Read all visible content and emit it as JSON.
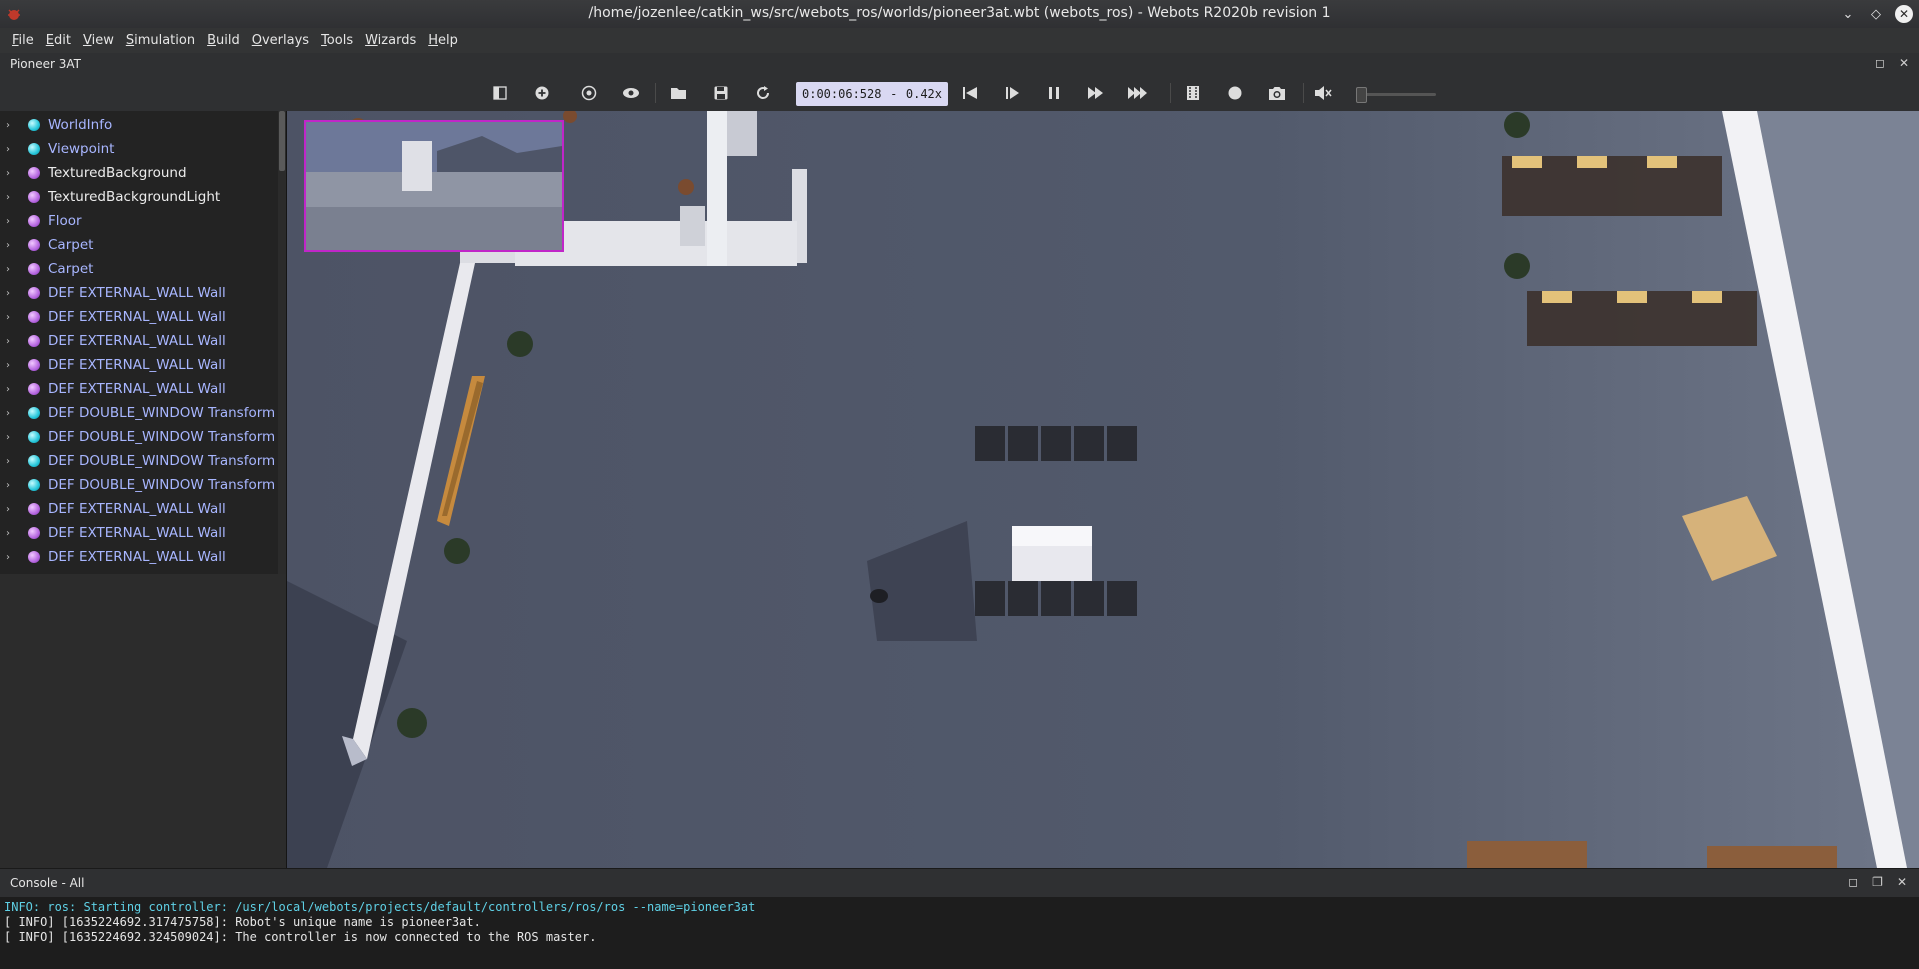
{
  "window": {
    "title": "/home/jozenlee/catkin_ws/src/webots_ros/worlds/pioneer3at.wbt (webots_ros) - Webots R2020b revision 1"
  },
  "menu": [
    "File",
    "Edit",
    "View",
    "Simulation",
    "Build",
    "Overlays",
    "Tools",
    "Wizards",
    "Help"
  ],
  "robot_window": {
    "label": "Pioneer 3AT"
  },
  "toolbar": {
    "icons": [
      "toggle-scene-tree-icon",
      "add-node-icon",
      "reset-viewpoint-icon",
      "view-eye-icon",
      "open-world-icon",
      "save-world-icon",
      "reload-world-icon",
      "step-back-icon",
      "step-icon",
      "pause-icon",
      "run-icon",
      "fast-run-icon",
      "record-movie-icon",
      "record-animation-icon",
      "screenshot-icon",
      "sound-mute-icon"
    ],
    "simulation_time": "0:00:06:528",
    "speed_separator": "-",
    "speed_factor": "0.42x"
  },
  "scene_tree": [
    {
      "label": "WorldInfo",
      "dot": "cyan",
      "style": "blue"
    },
    {
      "label": "Viewpoint",
      "dot": "cyan",
      "style": "blue"
    },
    {
      "label": "TexturedBackground",
      "dot": "purple",
      "style": "white"
    },
    {
      "label": "TexturedBackgroundLight",
      "dot": "purple",
      "style": "white"
    },
    {
      "label": "Floor",
      "dot": "purple",
      "style": "blue"
    },
    {
      "label": "Carpet",
      "dot": "purple",
      "style": "blue"
    },
    {
      "label": "Carpet",
      "dot": "purple",
      "style": "blue"
    },
    {
      "label": "DEF EXTERNAL_WALL Wall",
      "dot": "purple",
      "style": "blue"
    },
    {
      "label": "DEF EXTERNAL_WALL Wall",
      "dot": "purple",
      "style": "blue"
    },
    {
      "label": "DEF EXTERNAL_WALL Wall",
      "dot": "purple",
      "style": "blue"
    },
    {
      "label": "DEF EXTERNAL_WALL Wall",
      "dot": "purple",
      "style": "blue"
    },
    {
      "label": "DEF EXTERNAL_WALL Wall",
      "dot": "purple",
      "style": "blue"
    },
    {
      "label": "DEF DOUBLE_WINDOW Transform",
      "dot": "cyan",
      "style": "blue"
    },
    {
      "label": "DEF DOUBLE_WINDOW Transform",
      "dot": "cyan",
      "style": "blue"
    },
    {
      "label": "DEF DOUBLE_WINDOW Transform",
      "dot": "cyan",
      "style": "blue"
    },
    {
      "label": "DEF DOUBLE_WINDOW Transform",
      "dot": "cyan",
      "style": "blue"
    },
    {
      "label": "DEF EXTERNAL_WALL Wall",
      "dot": "purple",
      "style": "blue"
    },
    {
      "label": "DEF EXTERNAL_WALL Wall",
      "dot": "purple",
      "style": "blue"
    },
    {
      "label": "DEF EXTERNAL_WALL Wall",
      "dot": "purple",
      "style": "blue"
    }
  ],
  "console": {
    "title": "Console - All",
    "lines": [
      {
        "text": "INFO: ros: Starting controller: /usr/local/webots/projects/default/controllers/ros/ros --name=pioneer3at",
        "color": "#5fd1e6"
      },
      {
        "text": "[ INFO] [1635224692.317475758]: Robot's unique name is pioneer3at.",
        "color": "#e6e6e6"
      },
      {
        "text": "[ INFO] [1635224692.324509024]: The controller is now connected to the ROS master.",
        "color": "#e6e6e6"
      }
    ]
  },
  "colors": {
    "accent": "#d9d8f2",
    "tree_text": "#a8b6ff",
    "camera_overlay_border": "#c026c8"
  }
}
